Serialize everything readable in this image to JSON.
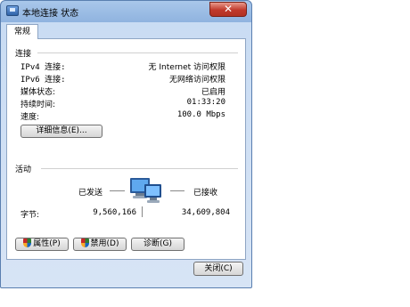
{
  "window": {
    "title": "本地连接 状态",
    "close_glyph": "✕"
  },
  "tabs": {
    "general": "常规"
  },
  "connection": {
    "heading": "连接",
    "rows": [
      {
        "label": "IPv4 连接:",
        "value": "无 Internet 访问权限"
      },
      {
        "label": "IPv6 连接:",
        "value": "无网络访问权限"
      },
      {
        "label": "媒体状态:",
        "value": "已启用"
      },
      {
        "label": "持续时间:",
        "value": "01:33:20"
      },
      {
        "label": "速度:",
        "value": "100.0 Mbps"
      }
    ],
    "details_button": "详细信息(E)..."
  },
  "activity": {
    "heading": "活动",
    "sent_label": "已发送",
    "received_label": "已接收",
    "bytes_label": "字节:",
    "bytes_sent": "9,560,166",
    "bytes_received": "34,609,804"
  },
  "buttons": {
    "properties": "属性(P)",
    "disable": "禁用(D)",
    "diagnose": "诊断(G)",
    "close": "关闭(C)"
  },
  "icons": {
    "title": "network-connection-icon",
    "activity": "network-computers-icon",
    "shield": "uac-shield-icon"
  }
}
